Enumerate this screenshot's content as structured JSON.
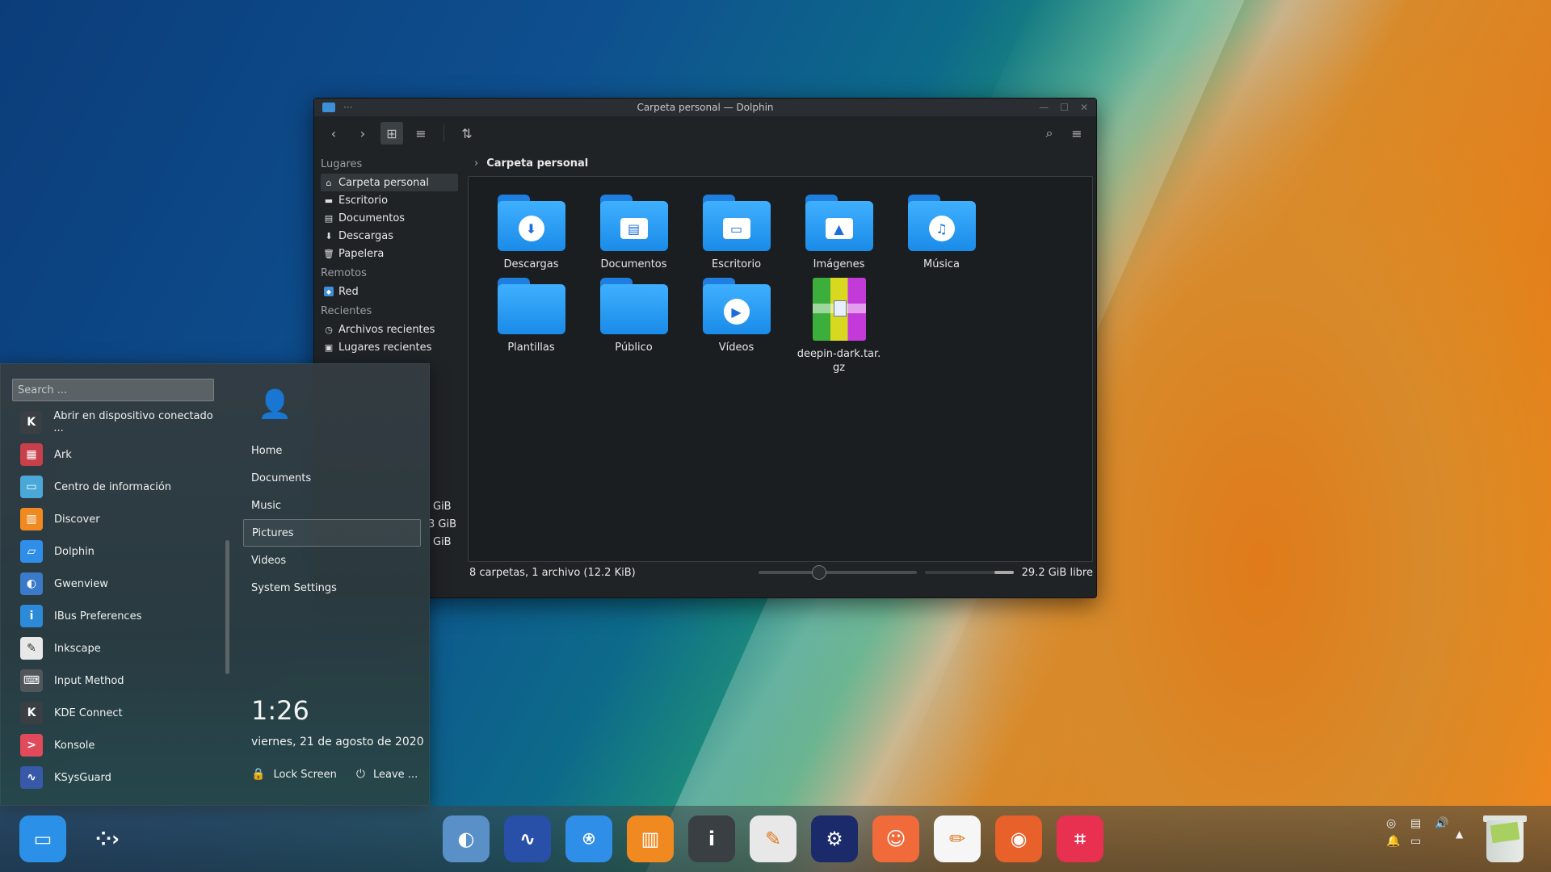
{
  "window": {
    "title": "Carpeta personal — Dolphin",
    "more": "···",
    "buttons": {
      "minimize": "—",
      "maximize": "☐",
      "close": "✕"
    }
  },
  "toolbar": {
    "back": "‹",
    "forward": "›",
    "icons_view": "⊞",
    "details_view": "≡",
    "sort": "⇅",
    "search": "⌕",
    "menu": "≡"
  },
  "places": {
    "sections": [
      {
        "title": "Lugares",
        "items": [
          {
            "label": "Carpeta personal",
            "icon": "home-icon",
            "glyph": "⌂",
            "selected": true
          },
          {
            "label": "Escritorio",
            "icon": "desktop-icon",
            "glyph": "▬"
          },
          {
            "label": "Documentos",
            "icon": "document-icon",
            "glyph": "▤"
          },
          {
            "label": "Descargas",
            "icon": "download-icon",
            "glyph": "⬇"
          },
          {
            "label": "Papelera",
            "icon": "trash-icon",
            "glyph": "🗑"
          }
        ]
      },
      {
        "title": "Remotos",
        "items": [
          {
            "label": "Red",
            "icon": "network-icon",
            "glyph": "◆"
          }
        ]
      },
      {
        "title": "Recientes",
        "items": [
          {
            "label": "Archivos recientes",
            "icon": "clock-icon",
            "glyph": "◷"
          },
          {
            "label": "Lugares recientes",
            "icon": "recent-places-icon",
            "glyph": "▣"
          }
        ]
      }
    ]
  },
  "breadcrumb": {
    "chevron": "›",
    "current": "Carpeta personal"
  },
  "files": [
    {
      "label": "Descargas",
      "kind": "folder",
      "emblem": "⬇"
    },
    {
      "label": "Documentos",
      "kind": "folder",
      "emblem": "▤"
    },
    {
      "label": "Escritorio",
      "kind": "folder",
      "emblem": "▭"
    },
    {
      "label": "Imágenes",
      "kind": "folder",
      "emblem": "▲"
    },
    {
      "label": "Música",
      "kind": "folder",
      "emblem": "♫"
    },
    {
      "label": "Plantillas",
      "kind": "folder",
      "emblem": ""
    },
    {
      "label": "Público",
      "kind": "folder",
      "emblem": ""
    },
    {
      "label": "Vídeos",
      "kind": "folder",
      "emblem": "▶"
    },
    {
      "label": "deepin-dark.tar.gz",
      "kind": "archive",
      "emblem": ""
    }
  ],
  "statusbar": {
    "summary": "8 carpetas, 1 archivo (12.2 KiB)",
    "free": "29.2 GiB libre"
  },
  "hidden_peek": {
    "a": "GiB",
    "b": "3 GiB",
    "c": "GiB"
  },
  "launcher": {
    "search_placeholder": "Search ...",
    "apps": [
      {
        "label": "Abrir en dispositivo conectado ...",
        "color": "#3a3f44",
        "glyph": "K"
      },
      {
        "label": "Ark",
        "color": "#c8404a",
        "glyph": "▦"
      },
      {
        "label": "Centro de información",
        "color": "#4aa8d8",
        "glyph": "▭"
      },
      {
        "label": "Discover",
        "color": "#f08a20",
        "glyph": "▥"
      },
      {
        "label": "Dolphin",
        "color": "#2f8ee8",
        "glyph": "▱"
      },
      {
        "label": "Gwenview",
        "color": "#3a7ac8",
        "glyph": "◐"
      },
      {
        "label": "IBus Preferences",
        "color": "#2c8ad8",
        "glyph": "i"
      },
      {
        "label": "Inkscape",
        "color": "#e8e8e8",
        "glyph": "✎"
      },
      {
        "label": "Input Method",
        "color": "#50565a",
        "glyph": "⌨"
      },
      {
        "label": "KDE Connect",
        "color": "#3a3f44",
        "glyph": "K"
      },
      {
        "label": "Konsole",
        "color": "#e04a5a",
        "glyph": ">"
      },
      {
        "label": "KSysGuard",
        "color": "#3858a8",
        "glyph": "∿"
      }
    ],
    "avatar_glyph": "👤",
    "places": [
      {
        "label": "Home"
      },
      {
        "label": "Documents"
      },
      {
        "label": "Music"
      },
      {
        "label": "Pictures",
        "selected": true
      },
      {
        "label": "Videos"
      },
      {
        "label": "System Settings"
      }
    ],
    "time": "1:26",
    "date": "viernes, 21 de agosto de 2020",
    "lock_label": "Lock Screen",
    "leave_label": "Leave ...",
    "lock_glyph": "🔒",
    "leave_glyph": "⏻"
  },
  "dock": {
    "apps": [
      {
        "name": "files-dock-icon",
        "color": "#2a90e8",
        "glyph": "▭"
      },
      {
        "name": "launcher-dock-icon",
        "color": "transparent",
        "glyph": "⁘›"
      },
      {
        "name": "gwenview-dock-icon",
        "color": "#5a90c8",
        "glyph": "◐"
      },
      {
        "name": "ksysguard-dock-icon",
        "color": "#2850a8",
        "glyph": "∿"
      },
      {
        "name": "dolphin-dock-icon",
        "color": "#2f8ee8",
        "glyph": "⍟"
      },
      {
        "name": "discover-dock-icon",
        "color": "#f08a20",
        "glyph": "▥"
      },
      {
        "name": "info-dock-icon",
        "color": "#3a3f44",
        "glyph": "i"
      },
      {
        "name": "inkscape-dock-icon",
        "color": "#e8e8e8",
        "glyph": "✎"
      },
      {
        "name": "settings-dock-icon",
        "color": "#1a2a6a",
        "glyph": "⚙"
      },
      {
        "name": "emoji-dock-icon",
        "color": "#f06a3a",
        "glyph": "☺"
      },
      {
        "name": "editor-dock-icon",
        "color": "#f6f6f6",
        "glyph": "✏"
      },
      {
        "name": "firefox-dock-icon",
        "color": "#e8602a",
        "glyph": "◉"
      },
      {
        "name": "crop-dock-icon",
        "color": "#e83050",
        "glyph": "⌗"
      }
    ],
    "tray": [
      "◎",
      "▤",
      "🔊",
      "🔔",
      "▭"
    ],
    "tray_expand": "▲"
  }
}
